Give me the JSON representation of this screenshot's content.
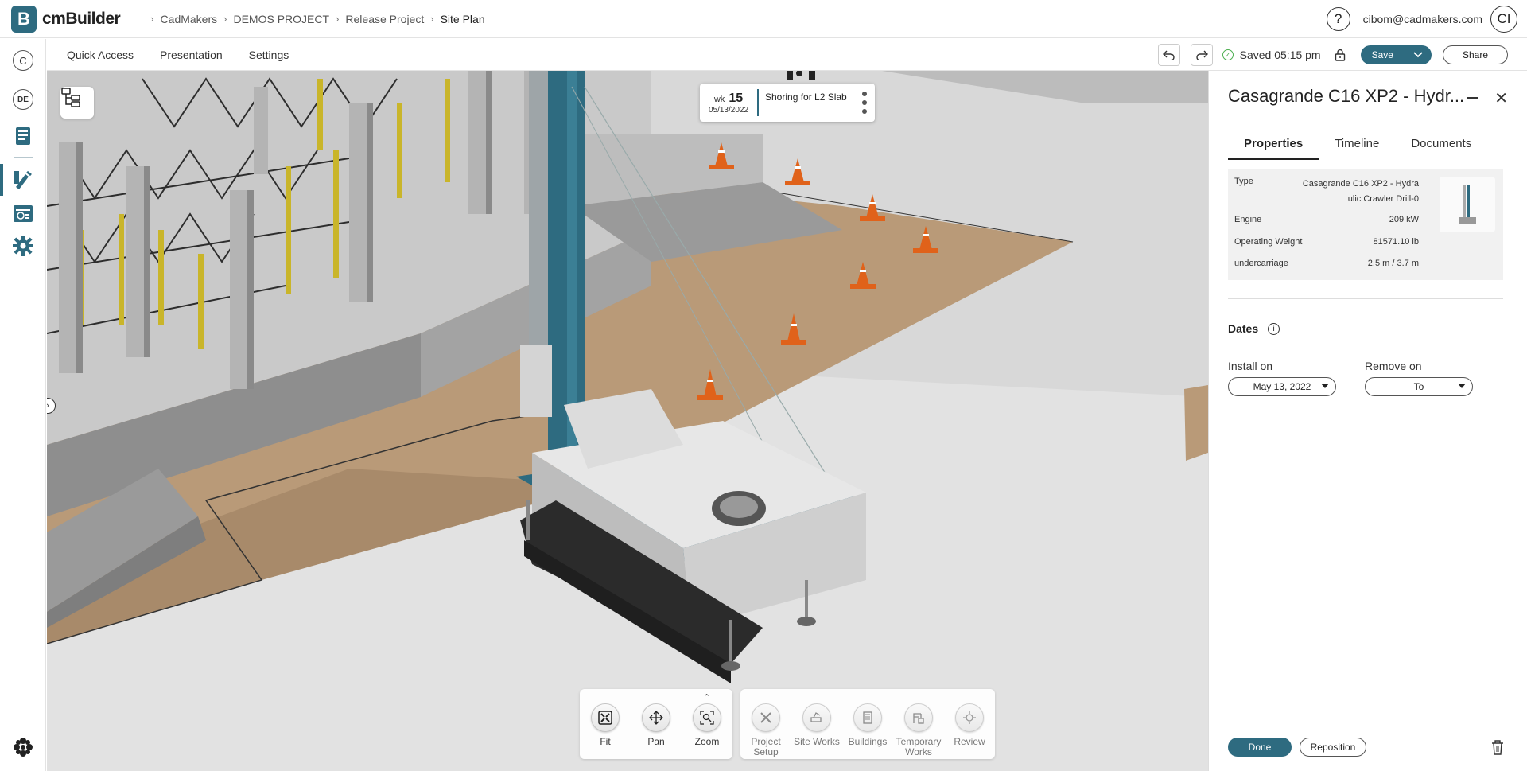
{
  "app": {
    "logo_letter": "B",
    "name": "cmBuilder"
  },
  "breadcrumb": [
    "CadMakers",
    "DEMOS PROJECT",
    "Release Project",
    "Site Plan"
  ],
  "user": {
    "help": "?",
    "email": "cibom@cadmakers.com",
    "initials": "CI"
  },
  "leftrail": {
    "top_circle": "C",
    "lang_circle": "DE"
  },
  "menu": [
    "Quick Access",
    "Presentation",
    "Settings"
  ],
  "toolbar": {
    "saved_text": "Saved 05:15 pm",
    "save_label": "Save",
    "share_label": "Share"
  },
  "schedule_card": {
    "week_prefix": "wk",
    "week_number": "15",
    "date": "05/13/2022",
    "task": "Shoring for L2 Slab"
  },
  "view_tools": [
    {
      "label": "Fit",
      "icon": "fit-icon"
    },
    {
      "label": "Pan",
      "icon": "pan-icon"
    },
    {
      "label": "Zoom",
      "icon": "zoom-icon"
    }
  ],
  "build_tools": [
    {
      "label": "Project Setup",
      "icon": "project-setup-icon"
    },
    {
      "label": "Site Works",
      "icon": "site-works-icon"
    },
    {
      "label": "Buildings",
      "icon": "buildings-icon"
    },
    {
      "label": "Temporary Works",
      "icon": "temporary-works-icon"
    },
    {
      "label": "Review",
      "icon": "review-icon"
    }
  ],
  "panel": {
    "title": "Casagrande C16 XP2 - Hydr...",
    "tabs": [
      "Properties",
      "Timeline",
      "Documents"
    ],
    "active_tab": "Properties",
    "properties": [
      {
        "key": "Type",
        "value": "Casagrande C16 XP2 - Hydra ulic Crawler Drill-0"
      },
      {
        "key": "Engine",
        "value": "209 kW"
      },
      {
        "key": "Operating Weight",
        "value": "81571.10 lb"
      },
      {
        "key": "undercarriage",
        "value": "2.5 m / 3.7 m"
      }
    ],
    "dates_title": "Dates",
    "install_label": "Install on",
    "install_value": "May 13, 2022",
    "remove_label": "Remove on",
    "remove_value": "To",
    "done_label": "Done",
    "reposition_label": "Reposition"
  },
  "colors": {
    "accent": "#2e6b80",
    "saved_green": "#4caf50"
  }
}
